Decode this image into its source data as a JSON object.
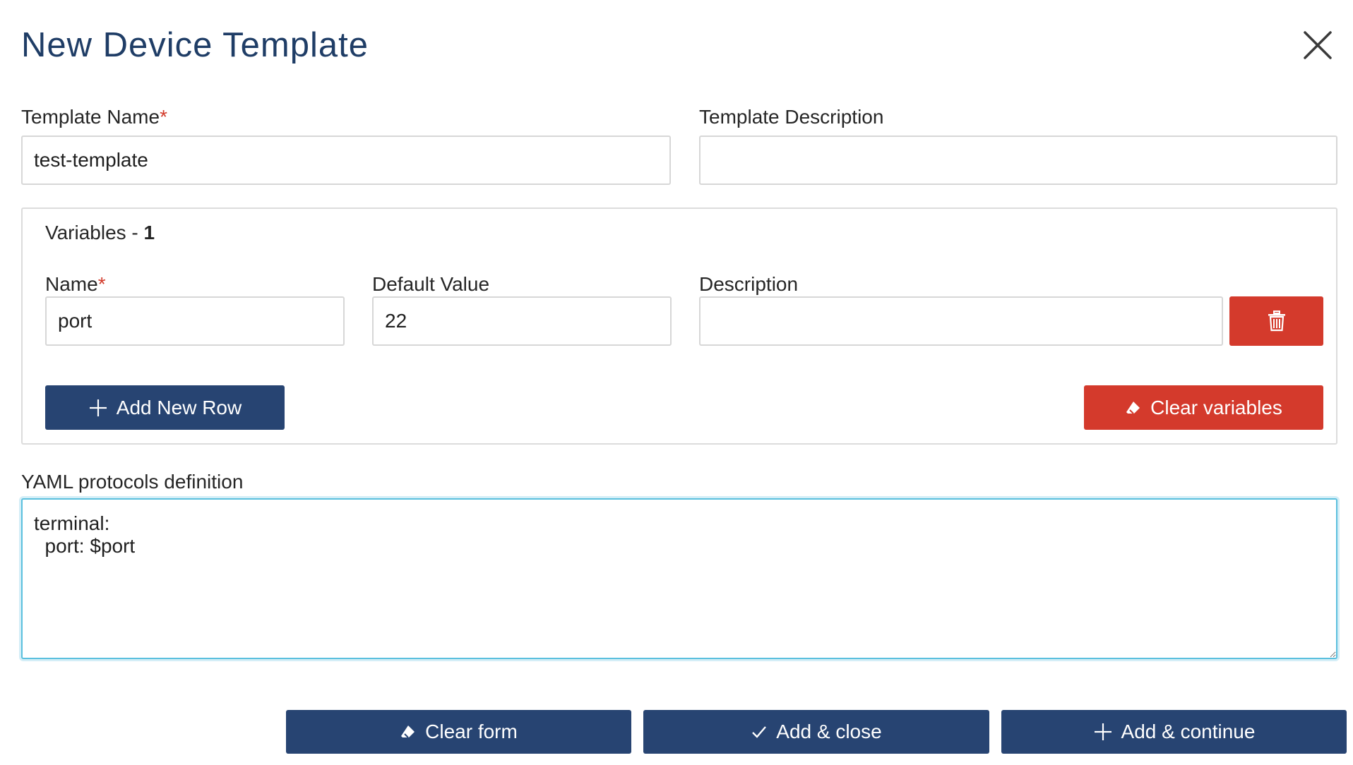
{
  "dialog": {
    "title": "New Device Template"
  },
  "form": {
    "template_name": {
      "label": "Template Name",
      "required_mark": "*",
      "value": "test-template"
    },
    "template_description": {
      "label": "Template Description",
      "value": ""
    }
  },
  "variables": {
    "heading": "Variables - ",
    "count": "1",
    "columns": {
      "name": "Name",
      "name_required_mark": "*",
      "default_value": "Default Value",
      "description": "Description"
    },
    "rows": [
      {
        "name": "port",
        "default_value": "22",
        "description": ""
      }
    ],
    "add_row_label": "Add New Row",
    "clear_label": "Clear variables"
  },
  "yaml": {
    "label": "YAML protocols definition",
    "value": "terminal:\n  port: $port"
  },
  "footer": {
    "clear_form_label": "Clear form",
    "add_close_label": "Add & close",
    "add_continue_label": "Add & continue"
  },
  "colors": {
    "primary": "#274472",
    "danger": "#d43a2c",
    "title": "#1f3d66",
    "focus": "#5bc0de",
    "required": "#d23a2a"
  },
  "icons": {
    "close": "close-icon",
    "trash": "trash-icon",
    "plus": "plus-icon",
    "eraser": "eraser-icon",
    "check": "check-icon"
  }
}
